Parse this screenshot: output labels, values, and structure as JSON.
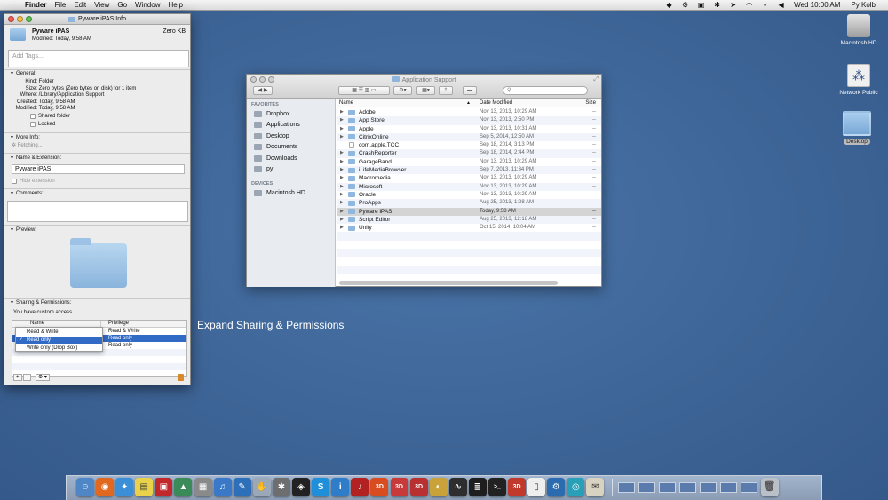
{
  "menubar": {
    "apple": "",
    "app_name": "Finder",
    "menus": [
      "File",
      "Edit",
      "View",
      "Go",
      "Window",
      "Help"
    ],
    "status_icons": [
      "dropbox-icon",
      "gear-icon",
      "cardhop-icon",
      "bluetooth-icon",
      "location-icon",
      "wifi-icon",
      "lock-icon",
      "volume-icon"
    ],
    "clock": "Wed 10:00 AM",
    "user": "Py Kolb"
  },
  "info_window": {
    "title": "Pyware iPAS Info",
    "name": "Pyware iPAS",
    "size_label": "Zero KB",
    "modified_header": "Modified: Today, 9:58 AM",
    "tags_placeholder": "Add Tags...",
    "general": {
      "heading": "General:",
      "kind_key": "Kind:",
      "kind_value": "Folder",
      "size_key": "Size:",
      "size_value": "Zero bytes (Zero bytes on disk) for 1 item",
      "where_key": "Where:",
      "where_value": "/Library/Application Support",
      "created_key": "Created:",
      "created_value": "Today, 9:58 AM",
      "modified_key": "Modified:",
      "modified_value": "Today, 9:58 AM",
      "shared_folder": "Shared folder",
      "locked": "Locked"
    },
    "more_info": {
      "heading": "More Info:",
      "fetching": "Fetching..."
    },
    "name_extension": {
      "heading": "Name & Extension:",
      "value": "Pyware iPAS",
      "hide_extension": "Hide extension"
    },
    "comments": {
      "heading": "Comments:"
    },
    "preview": {
      "heading": "Preview:"
    },
    "sharing": {
      "heading": "Sharing & Permissions:",
      "status": "You have custom access",
      "col_name": "Name",
      "col_privilege": "Privilege",
      "rows": [
        {
          "privilege": "Read & Write"
        },
        {
          "privilege": "Read only"
        },
        {
          "privilege": "Read only"
        }
      ],
      "popup_options": [
        "Read & Write",
        "Read only",
        "Write only (Drop Box)"
      ],
      "popup_selected": "Read only",
      "add_btn": "+",
      "remove_btn": "–",
      "action_btn": "⚙ ▾"
    }
  },
  "overlay_caption": "Expand Sharing & Permissions",
  "finder": {
    "title": "Application Support",
    "search_placeholder": "",
    "sidebar": {
      "favorites_heading": "FAVORITES",
      "favorites": [
        "Dropbox",
        "Applications",
        "Desktop",
        "Documents",
        "Downloads",
        "py"
      ],
      "devices_heading": "DEVICES",
      "devices": [
        "Macintosh HD"
      ]
    },
    "columns": {
      "name": "Name",
      "date": "Date Modified",
      "size": "Size"
    },
    "files": [
      {
        "name": "Adobe",
        "date": "Nov 13, 2013, 10:29 AM",
        "size": "--"
      },
      {
        "name": "App Store",
        "date": "Nov 13, 2013, 2:50 PM",
        "size": "--"
      },
      {
        "name": "Apple",
        "date": "Nov 13, 2013, 10:31 AM",
        "size": "--"
      },
      {
        "name": "CitrixOnline",
        "date": "Sep 5, 2014, 12:50 AM",
        "size": "--"
      },
      {
        "name": "com.apple.TCC",
        "date": "Sep 18, 2014, 3:13 PM",
        "size": "--"
      },
      {
        "name": "CrashReporter",
        "date": "Sep 18, 2014, 2:44 PM",
        "size": "--"
      },
      {
        "name": "GarageBand",
        "date": "Nov 13, 2013, 10:29 AM",
        "size": "--"
      },
      {
        "name": "iLifeMediaBrowser",
        "date": "Sep 7, 2013, 11:34 PM",
        "size": "--"
      },
      {
        "name": "Macromedia",
        "date": "Nov 13, 2013, 10:29 AM",
        "size": "--"
      },
      {
        "name": "Microsoft",
        "date": "Nov 13, 2013, 10:29 AM",
        "size": "--"
      },
      {
        "name": "Oracle",
        "date": "Nov 13, 2013, 10:29 AM",
        "size": "--"
      },
      {
        "name": "ProApps",
        "date": "Aug 25, 2013, 1:28 AM",
        "size": "--"
      },
      {
        "name": "Pyware iPAS",
        "date": "Today, 9:58 AM",
        "size": "--"
      },
      {
        "name": "Script Editor",
        "date": "Aug 25, 2013, 12:18 AM",
        "size": "--"
      },
      {
        "name": "Unity",
        "date": "Oct 15, 2014, 10:04 AM",
        "size": "--"
      }
    ]
  },
  "desktop_icons": [
    "Macintosh HD",
    "Network Public",
    "Desktop"
  ],
  "dock": {
    "apps": [
      {
        "icon": "finder-icon",
        "color": "#4f86c6",
        "glyph": "☺"
      },
      {
        "icon": "firefox-icon",
        "color": "#e0681f",
        "glyph": "◉"
      },
      {
        "icon": "safari-icon",
        "color": "#3b8fd6",
        "glyph": "✦"
      },
      {
        "icon": "stickies-icon",
        "color": "#e9d24a",
        "glyph": "▤"
      },
      {
        "icon": "photo-booth-icon",
        "color": "#c0282b",
        "glyph": "▣"
      },
      {
        "icon": "app-store-icon",
        "color": "#3a8a5a",
        "glyph": "▲"
      },
      {
        "icon": "photos-icon",
        "color": "#8a8a8a",
        "glyph": "▦"
      },
      {
        "icon": "itunes-icon",
        "color": "#3a78c8",
        "glyph": "♫"
      },
      {
        "icon": "xcode-icon",
        "color": "#2d6fb8",
        "glyph": "✎"
      },
      {
        "icon": "preview-icon",
        "color": "#9aa8b8",
        "glyph": "✋"
      },
      {
        "icon": "system-prefs-icon",
        "color": "#6e6e6e",
        "glyph": "✱"
      },
      {
        "icon": "unity-icon",
        "color": "#222222",
        "glyph": "◈"
      },
      {
        "icon": "skype-icon",
        "color": "#1f8fd9",
        "glyph": "S"
      },
      {
        "icon": "info-icon",
        "color": "#2f7cc9",
        "glyph": "i"
      },
      {
        "icon": "garageband-icon",
        "color": "#b22222",
        "glyph": "♪"
      },
      {
        "icon": "3d-app-1-icon",
        "color": "#d94c1f",
        "glyph": "3D"
      },
      {
        "icon": "3d-app-2-icon",
        "color": "#c83a3a",
        "glyph": "3D"
      },
      {
        "icon": "3d-app-3-icon",
        "color": "#b83030",
        "glyph": "3D"
      },
      {
        "icon": "cyberduck-icon",
        "color": "#c9a23a",
        "glyph": "◐"
      },
      {
        "icon": "activity-monitor-icon",
        "color": "#2e2e2e",
        "glyph": "∿"
      },
      {
        "icon": "console-icon",
        "color": "#1e1e1e",
        "glyph": "≣"
      },
      {
        "icon": "terminal-icon",
        "color": "#222222",
        "glyph": ">_"
      },
      {
        "icon": "3d-app-4-icon",
        "color": "#c0392b",
        "glyph": "3D"
      },
      {
        "icon": "textedit-icon",
        "color": "#eeeeee",
        "glyph": "▯"
      },
      {
        "icon": "settings-icon",
        "color": "#2b6cb0",
        "glyph": "⚙"
      },
      {
        "icon": "globe-icon",
        "color": "#2aa0b8",
        "glyph": "◎"
      },
      {
        "icon": "envelope-icon",
        "color": "#d8d2c0",
        "glyph": "✉"
      }
    ],
    "minimized_count": 7,
    "trash": "trash-icon"
  }
}
